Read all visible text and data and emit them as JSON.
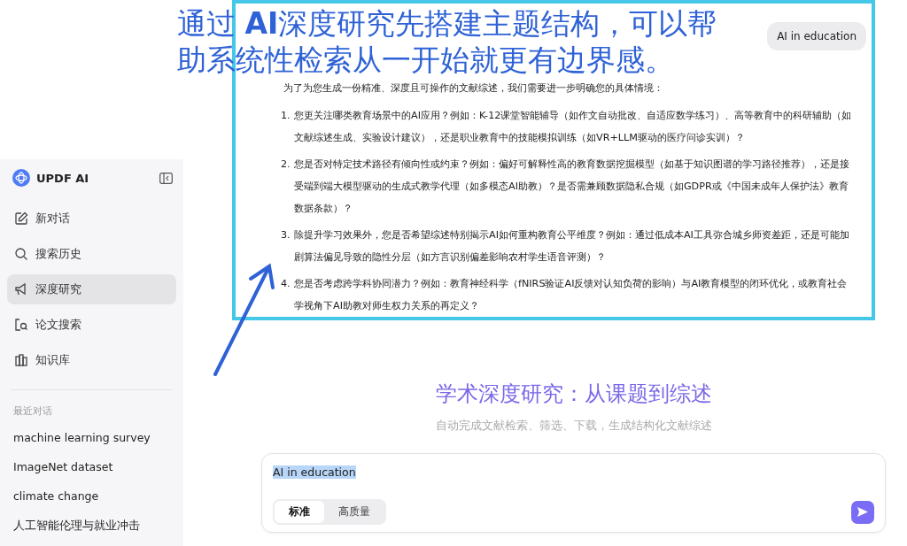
{
  "annotation": {
    "caption": "通过 **AI**深度研究先搭建主题结构，可以帮助系统性检索从一开始就更有边界感。",
    "highlight": true,
    "arrow": true
  },
  "sidebar": {
    "brand": "UPDF AI",
    "items": [
      {
        "label": "新对话",
        "selected": false
      },
      {
        "label": "搜索历史",
        "selected": false
      },
      {
        "label": "深度研究",
        "selected": true
      },
      {
        "label": "论文搜索",
        "selected": false
      },
      {
        "label": "知识库",
        "selected": false
      }
    ],
    "recent_heading": "最近对话",
    "recent": [
      "machine learning survey",
      "ImageNet dataset",
      "climate change",
      "人工智能伦理与就业冲击"
    ]
  },
  "chat": {
    "user_message": "AI in education",
    "intro": "为了为您生成一份精准、深度且可操作的文献综述，我们需要进一步明确您的具体情境：",
    "questions": [
      {
        "number": "1.",
        "text": "您更关注哪类教育场景中的AI应用？例如：K-12课堂智能辅导（如作文自动批改、自适应数学练习）、高等教育中的科研辅助（如文献综述生成、实验设计建议），还是职业教育中的技能模拟训练（如VR+LLM驱动的医疗问诊实训）？"
      },
      {
        "number": "2.",
        "text": "您是否对特定技术路径有倾向性或约束？例如：偏好可解释性高的教育数据挖掘模型（如基于知识图谱的学习路径推荐），还是接受端到端大模型驱动的生成式教学代理（如多模态AI助教）？是否需兼顾数据隐私合规（如GDPR或《中国未成年人保护法》教育数据条款）？"
      },
      {
        "number": "3.",
        "text": "除提升学习效果外，您是否希望综述特别揭示AI如何重构教育公平维度？例如：通过低成本AI工具弥合城乡师资差距，还是可能加剧算法偏见导致的隐性分层（如方言识别偏差影响农村学生语音评测）？"
      },
      {
        "number": "4.",
        "text": "您是否考虑跨学科协同潜力？例如：教育神经科学（fNIRS验证AI反馈对认知负荷的影响）与AI教育模型的闭环优化，或教育社会学视角下AI助教对师生权力关系的再定义？"
      }
    ]
  },
  "hero": {
    "title": "学术深度研究：从课题到综述",
    "subtitle": "自动完成文献检索、筛选、下载，生成结构化文献综述"
  },
  "composer": {
    "value": "AI in education",
    "text_selected": true,
    "modes": [
      {
        "label": "标准",
        "selected": true
      },
      {
        "label": "高质量",
        "selected": false
      }
    ]
  }
}
